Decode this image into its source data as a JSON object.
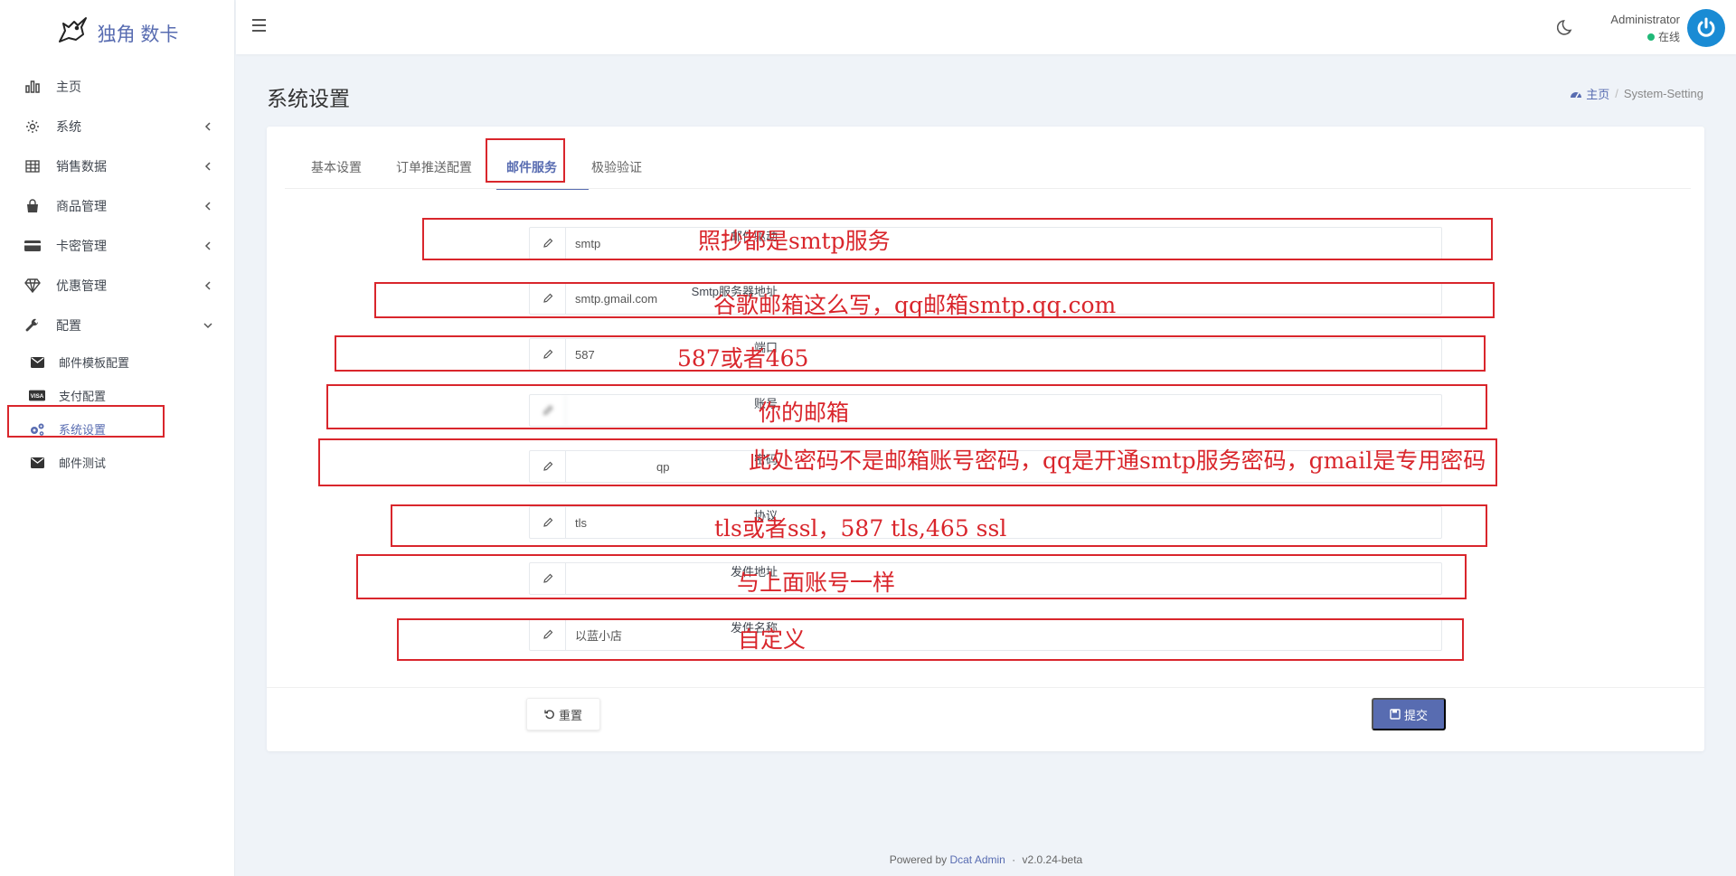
{
  "brand": {
    "name": "独角 数卡",
    "icon": "unicorn-logo-icon"
  },
  "sidebar": {
    "items": [
      {
        "label": "主页",
        "icon": "bar-chart-icon",
        "arrow": ""
      },
      {
        "label": "系统",
        "icon": "gear-icon",
        "arrow": "chevron-left-icon"
      },
      {
        "label": "销售数据",
        "icon": "table-icon",
        "arrow": "chevron-left-icon"
      },
      {
        "label": "商品管理",
        "icon": "shopping-bag-icon",
        "arrow": "chevron-left-icon"
      },
      {
        "label": "卡密管理",
        "icon": "credit-card-icon",
        "arrow": "chevron-left-icon"
      },
      {
        "label": "优惠管理",
        "icon": "diamond-icon",
        "arrow": "chevron-left-icon"
      },
      {
        "label": "配置",
        "icon": "wrench-icon",
        "arrow": "chevron-down-icon"
      }
    ],
    "subitems": [
      {
        "label": "邮件模板配置",
        "icon": "envelope-icon"
      },
      {
        "label": "支付配置",
        "icon": "visa-card-icon"
      },
      {
        "label": "系统设置",
        "icon": "cogs-icon",
        "active": true
      },
      {
        "label": "邮件测试",
        "icon": "envelope-icon"
      }
    ]
  },
  "topbar": {
    "menu_icon": "hamburger-icon",
    "theme_icon": "moon-icon",
    "user_name": "Administrator",
    "user_status": "在线",
    "avatar_icon": "power-icon"
  },
  "page": {
    "title": "系统设置",
    "breadcrumb_home": "主页",
    "breadcrumb_sep": "/",
    "breadcrumb_current": "System-Setting"
  },
  "tabs": [
    "基本设置",
    "订单推送配置",
    "邮件服务",
    "极验验证"
  ],
  "active_tab": "邮件服务",
  "form": {
    "fields": [
      {
        "label": "邮件驱动",
        "required": true,
        "value": "smtp"
      },
      {
        "label": "Smtp服务器地址",
        "required": false,
        "value": "smtp.gmail.com"
      },
      {
        "label": "端口",
        "required": false,
        "value": "587"
      },
      {
        "label": "账号",
        "required": false,
        "value": "",
        "blurred": true
      },
      {
        "label": "密码",
        "required": false,
        "value": "qp",
        "blurred": true
      },
      {
        "label": "协议",
        "required": false,
        "value": "tls"
      },
      {
        "label": "发件地址",
        "required": false,
        "value": "",
        "blurred": true
      },
      {
        "label": "发件名称",
        "required": false,
        "value": "以蓝小店"
      }
    ],
    "reset_label": "重置",
    "submit_label": "提交"
  },
  "footer": {
    "powered_prefix": "Powered by",
    "powered_link": "Dcat Admin",
    "powered_sep": "·",
    "version": "v2.0.24-beta"
  },
  "annotations": [
    "照抄都是smtp服务",
    "谷歌邮箱这么写，qq邮箱smtp.qq.com",
    "587或者465",
    "你的邮箱",
    "此处密码不是邮箱账号密码，qq是开通smtp服务密码，gmail是专用密码",
    "tls或者ssl，587 tls,465 ssl",
    "与上面账号一样",
    "自定义"
  ],
  "colors": {
    "accent": "#586cb1",
    "annotation": "#d9262c",
    "online": "#21b978"
  }
}
